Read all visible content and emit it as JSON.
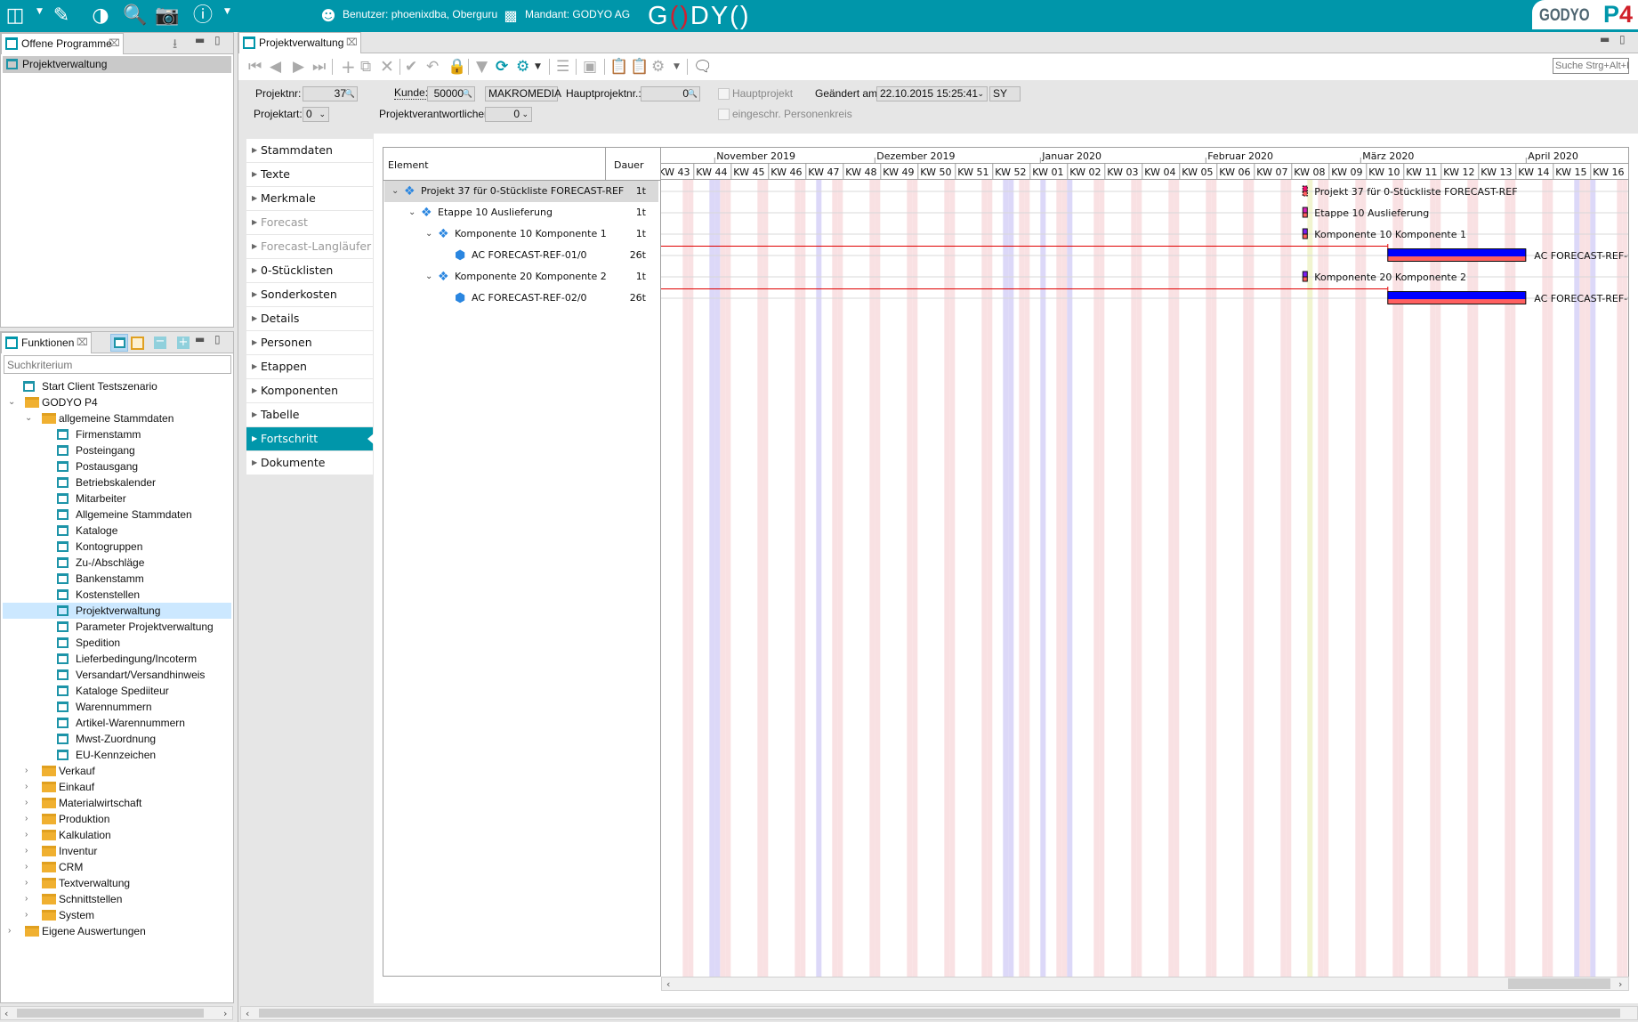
{
  "topbar": {
    "icons": [
      "layout-icon",
      "edit-icon",
      "pie-chart-icon",
      "document-search-icon",
      "camera-icon",
      "help-icon"
    ],
    "user_label": "Benutzer: phoenixdba, Oberguru",
    "tenant_label": "Mandant: GODYO AG",
    "logo_text": "GODYO",
    "brand_logo_text": "GODYO P4",
    "color": "#0096aa"
  },
  "open_programs": {
    "title": "Offene Programme",
    "items": [
      "Projektverwaltung"
    ]
  },
  "functions": {
    "title": "Funktionen",
    "search_placeholder": "Suchkriterium",
    "tree": [
      {
        "label": "Start Client Testszenario",
        "level": 0,
        "type": "window"
      },
      {
        "label": "GODYO P4",
        "level": 0,
        "type": "folder",
        "expanded": true
      },
      {
        "label": "allgemeine Stammdaten",
        "level": 1,
        "type": "folder",
        "expanded": true
      },
      {
        "label": "Firmenstamm",
        "level": 2,
        "type": "window"
      },
      {
        "label": "Posteingang",
        "level": 2,
        "type": "window"
      },
      {
        "label": "Postausgang",
        "level": 2,
        "type": "window"
      },
      {
        "label": "Betriebskalender",
        "level": 2,
        "type": "window"
      },
      {
        "label": "Mitarbeiter",
        "level": 2,
        "type": "window"
      },
      {
        "label": "Allgemeine Stammdaten",
        "level": 2,
        "type": "window"
      },
      {
        "label": "Kataloge",
        "level": 2,
        "type": "window"
      },
      {
        "label": "Kontogruppen",
        "level": 2,
        "type": "window"
      },
      {
        "label": "Zu-/Abschläge",
        "level": 2,
        "type": "window"
      },
      {
        "label": "Bankenstamm",
        "level": 2,
        "type": "window"
      },
      {
        "label": "Kostenstellen",
        "level": 2,
        "type": "window"
      },
      {
        "label": "Projektverwaltung",
        "level": 2,
        "type": "window",
        "selected": true
      },
      {
        "label": "Parameter Projektverwaltung",
        "level": 2,
        "type": "window"
      },
      {
        "label": "Spedition",
        "level": 2,
        "type": "window"
      },
      {
        "label": "Lieferbedingung/Incoterm",
        "level": 2,
        "type": "window"
      },
      {
        "label": "Versandart/Versandhinweis",
        "level": 2,
        "type": "window"
      },
      {
        "label": "Kataloge Spediiteur",
        "level": 2,
        "type": "window"
      },
      {
        "label": "Warennummern",
        "level": 2,
        "type": "window"
      },
      {
        "label": "Artikel-Warennummern",
        "level": 2,
        "type": "window"
      },
      {
        "label": "Mwst-Zuordnung",
        "level": 2,
        "type": "window"
      },
      {
        "label": "EU-Kennzeichen",
        "level": 2,
        "type": "window"
      },
      {
        "label": "Verkauf",
        "level": 1,
        "type": "folder",
        "expanded": false
      },
      {
        "label": "Einkauf",
        "level": 1,
        "type": "folder",
        "expanded": false
      },
      {
        "label": "Materialwirtschaft",
        "level": 1,
        "type": "folder",
        "expanded": false
      },
      {
        "label": "Produktion",
        "level": 1,
        "type": "folder",
        "expanded": false
      },
      {
        "label": "Kalkulation",
        "level": 1,
        "type": "folder",
        "expanded": false
      },
      {
        "label": "Inventur",
        "level": 1,
        "type": "folder",
        "expanded": false
      },
      {
        "label": "CRM",
        "level": 1,
        "type": "folder",
        "expanded": false
      },
      {
        "label": "Textverwaltung",
        "level": 1,
        "type": "folder",
        "expanded": false
      },
      {
        "label": "Schnittstellen",
        "level": 1,
        "type": "folder",
        "expanded": false
      },
      {
        "label": "System",
        "level": 1,
        "type": "folder",
        "expanded": false
      },
      {
        "label": "Eigene Auswertungen",
        "level": 0,
        "type": "folder",
        "expanded": false
      }
    ]
  },
  "main": {
    "tab_title": "Projektverwaltung",
    "search_placeholder": "Suche Strg+Alt+F",
    "toolbar_icons": [
      "first-icon",
      "previous-icon",
      "next-icon",
      "last-icon",
      "add-icon",
      "copy-icon",
      "delete-icon",
      "save-check-icon",
      "undo-icon",
      "lock-icon",
      "filter-icon",
      "refresh-icon",
      "gear-filter-icon",
      "list-icon",
      "id-card-icon",
      "clipboard-export-icon",
      "clipboard-clock-icon",
      "gears-icon",
      "chat-icon"
    ],
    "form": {
      "projektnr_label": "Projektnr:",
      "projektnr": "37",
      "kunde_label": "Kunde:",
      "kunde": "50000",
      "kunde_name": "MAKROMEDIA",
      "hauptprojektnr_label": "Hauptprojektnr.:",
      "hauptprojektnr": "0",
      "hauptprojekt_label": "Hauptprojekt",
      "hauptprojekt_checked": false,
      "geaendert_label": "Geändert am:",
      "geaendert": "22.10.2015 15:25:41",
      "geaendert_user": "SY",
      "projektart_label": "Projektart:",
      "projektart": "0",
      "verantwortlicher_label": "Projektverantwortlicher:",
      "verantwortlicher": "0",
      "personenkreis_label": "eingeschr. Personenkreis",
      "personenkreis_checked": false
    },
    "nav": [
      {
        "label": "Stammdaten",
        "state": "normal"
      },
      {
        "label": "Texte",
        "state": "normal"
      },
      {
        "label": "Merkmale",
        "state": "normal"
      },
      {
        "label": "Forecast",
        "state": "disabled"
      },
      {
        "label": "Forecast-Langläufer",
        "state": "disabled"
      },
      {
        "label": "0-Stücklisten",
        "state": "normal"
      },
      {
        "label": "Sonderkosten",
        "state": "normal"
      },
      {
        "label": "Details",
        "state": "normal"
      },
      {
        "label": "Personen",
        "state": "normal"
      },
      {
        "label": "Etappen",
        "state": "normal"
      },
      {
        "label": "Komponenten",
        "state": "normal"
      },
      {
        "label": "Tabelle",
        "state": "normal"
      },
      {
        "label": "Fortschritt",
        "state": "active"
      },
      {
        "label": "Dokumente",
        "state": "normal"
      }
    ]
  },
  "gantt": {
    "columns": {
      "element": "Element",
      "duration": "Dauer"
    },
    "months": [
      {
        "label": "November 2019",
        "start": "2019-11-01"
      },
      {
        "label": "Dezember 2019",
        "start": "2019-12-01"
      },
      {
        "label": "Januar 2020",
        "start": "2020-01-01"
      },
      {
        "label": "Februar 2020",
        "start": "2020-02-01"
      },
      {
        "label": "März 2020",
        "start": "2020-03-01"
      },
      {
        "label": "April 2020",
        "start": "2020-04-01"
      }
    ],
    "weeks": [
      "KW 43",
      "KW 44",
      "KW 45",
      "KW 46",
      "KW 47",
      "KW 48",
      "KW 49",
      "KW 50",
      "KW 51",
      "KW 52",
      "KW 01",
      "KW 02",
      "KW 03",
      "KW 04",
      "KW 05",
      "KW 06",
      "KW 07",
      "KW 08",
      "KW 09",
      "KW 10",
      "KW 11",
      "KW 12",
      "KW 13",
      "KW 14",
      "KW 15",
      "KW 16"
    ],
    "holidays": [
      "2019-10-31",
      "2019-11-01",
      "2019-11-20",
      "2019-12-25",
      "2019-12-26",
      "2020-01-01",
      "2020-01-06",
      "2020-04-10",
      "2020-04-13"
    ],
    "today": "2020-02-20",
    "colors": {
      "weekend": "#f9e1e3",
      "holiday": "#dcd8f8",
      "today": "#f1f4cf",
      "bar_top": "#0000ff",
      "bar_bottom": "#ff6060",
      "link": "#e00000"
    },
    "tasks": [
      {
        "name": "Projekt 37 für 0-Stückliste FORECAST-REF",
        "duration": "1t",
        "level": 0,
        "kind": "milestone",
        "start": "2020-02-19",
        "color": "#f0106a",
        "expanded": true
      },
      {
        "name": "Etappe 10 Auslieferung",
        "duration": "1t",
        "level": 1,
        "kind": "milestone",
        "start": "2020-02-19",
        "color": "#d820b8",
        "expanded": true
      },
      {
        "name": "Komponente 10 Komponente 1",
        "duration": "1t",
        "level": 2,
        "kind": "milestone",
        "start": "2020-02-19",
        "color": "#7a1ef0",
        "expanded": true
      },
      {
        "name": "AC FORECAST-REF-01/0",
        "duration": "26t",
        "level": 3,
        "kind": "bar",
        "start": "2020-03-06",
        "end": "2020-03-31"
      },
      {
        "name": "Komponente 20 Komponente 2",
        "duration": "1t",
        "level": 2,
        "kind": "milestone",
        "start": "2020-02-19",
        "color": "#7a1ef0",
        "expanded": true
      },
      {
        "name": "AC FORECAST-REF-02/0",
        "duration": "26t",
        "level": 3,
        "kind": "bar",
        "start": "2020-03-06",
        "end": "2020-03-31"
      }
    ]
  }
}
